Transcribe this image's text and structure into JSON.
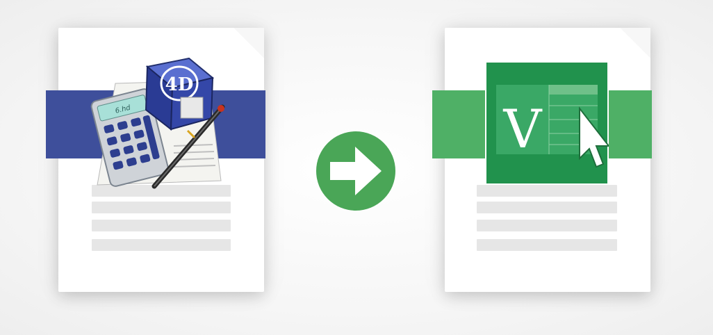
{
  "conversion": {
    "source_format": {
      "icon": "calculator-document-icon",
      "accent_color": "#3e4f9b",
      "logo_text": "4D"
    },
    "arrow": {
      "icon": "arrow-right-icon",
      "color": "#4aa657"
    },
    "target_format": {
      "icon": "spreadsheet-v-icon",
      "accent_color": "#2e9d55",
      "logo_text": "V"
    }
  }
}
